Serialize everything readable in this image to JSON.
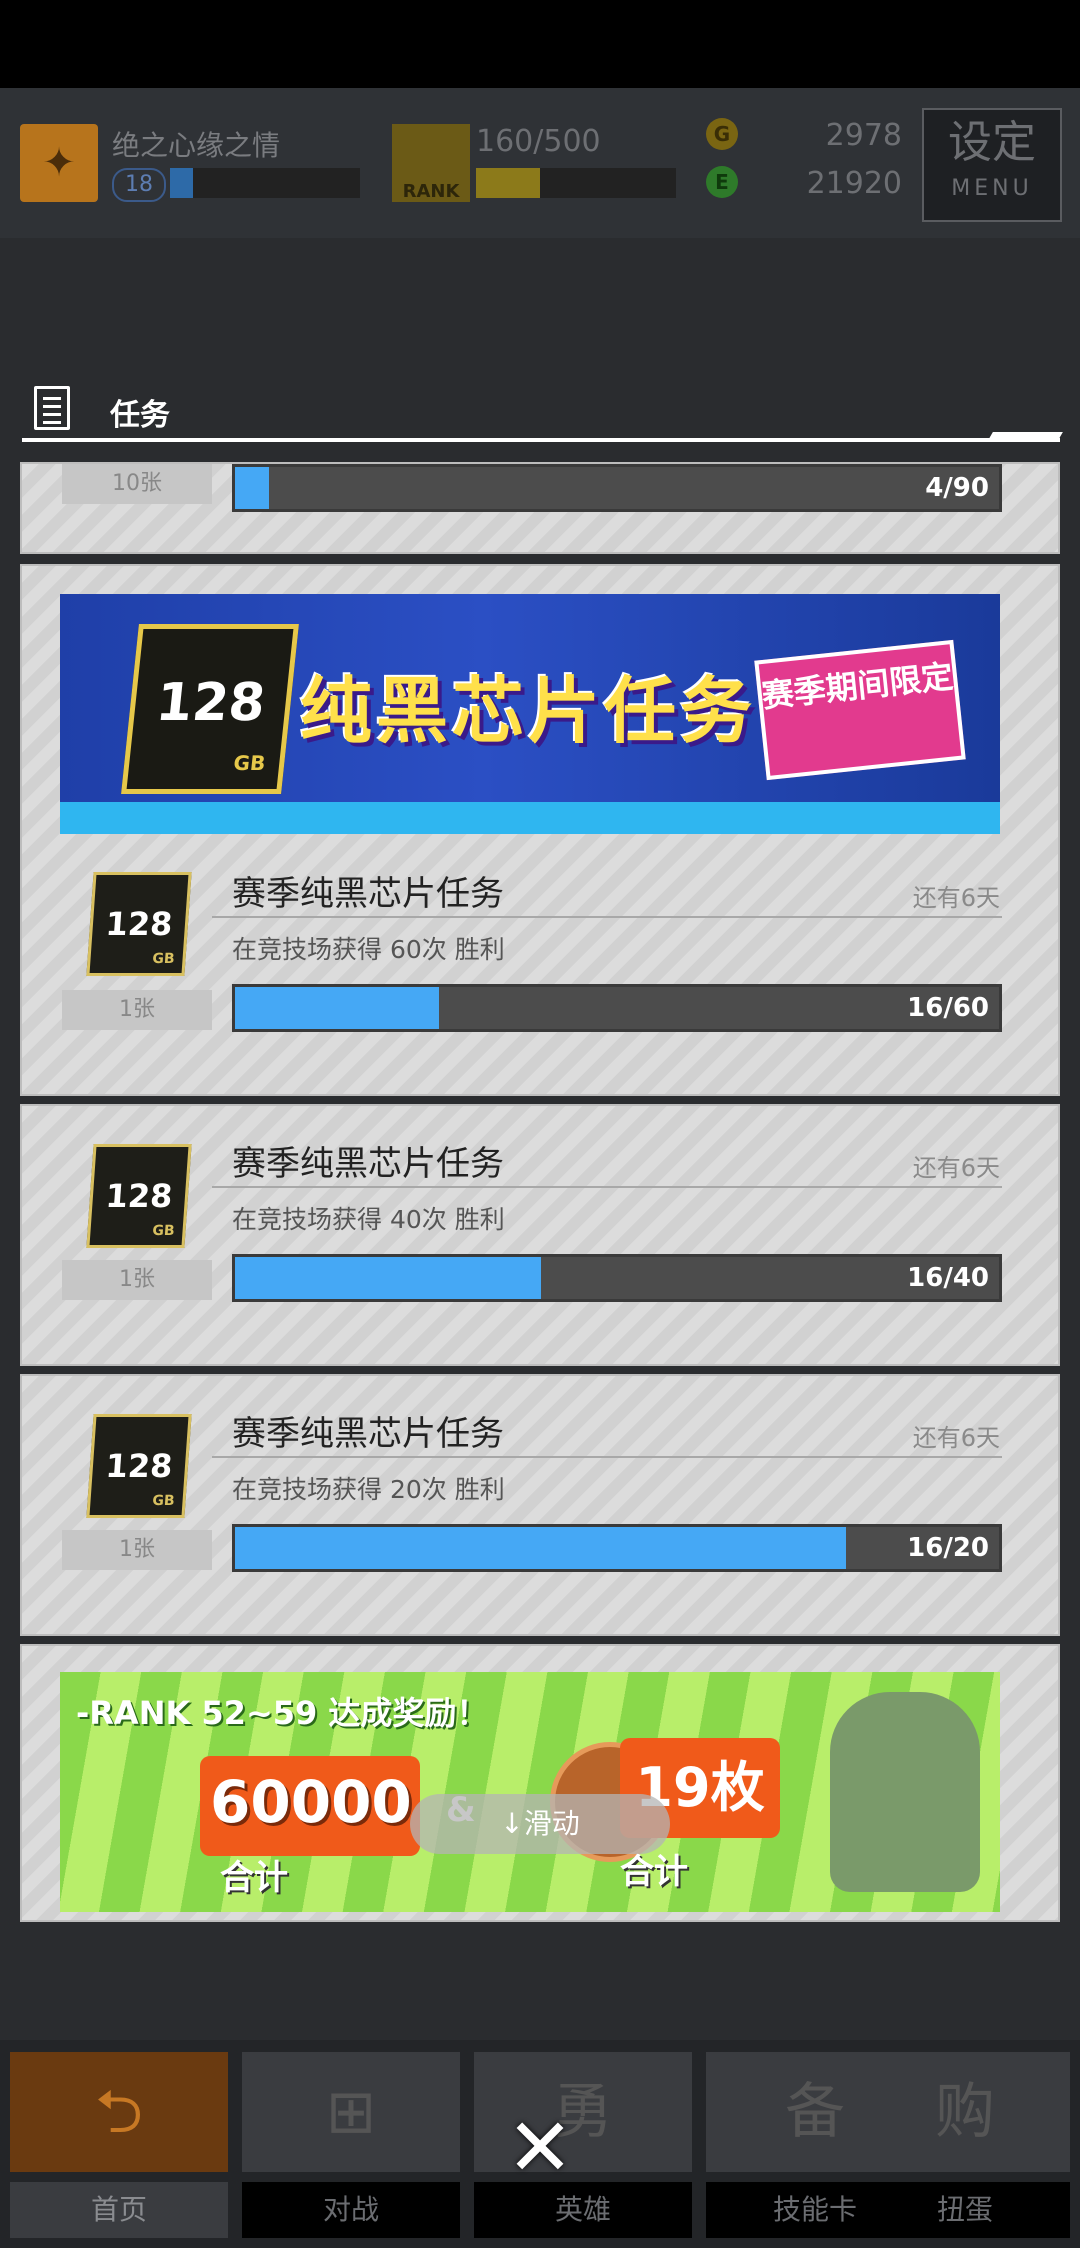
{
  "topbar": {
    "player_name": "绝之心缘之情",
    "level": "18",
    "xp_progress": 0.12,
    "rank_badge": "RANK",
    "rank_progress_text": "160/500",
    "rank_progress": 0.32,
    "coin1_symbol": "G",
    "coin1_value": "2978",
    "coin2_symbol": "E",
    "coin2_value": "21920",
    "menu_big": "设定",
    "menu_small": "MENU"
  },
  "section": {
    "title": "任务"
  },
  "partial_card": {
    "qty": "10张",
    "progress_text": "4/90",
    "progress": 0.044
  },
  "banner1": {
    "chip_num": "128",
    "chip_unit": "GB",
    "title": "纯黑芯片任务",
    "tag": "赛季期间限定"
  },
  "missions": [
    {
      "chip_num": "128",
      "chip_unit": "GB",
      "qty": "1张",
      "title": "赛季纯黑芯片任务",
      "remaining": "还有6天",
      "desc": "在竞技场获得  60次  胜利",
      "progress_text": "16/60",
      "progress": 0.267
    },
    {
      "chip_num": "128",
      "chip_unit": "GB",
      "qty": "1张",
      "title": "赛季纯黑芯片任务",
      "remaining": "还有6天",
      "desc": "在竞技场获得  40次  胜利",
      "progress_text": "16/40",
      "progress": 0.4
    },
    {
      "chip_num": "128",
      "chip_unit": "GB",
      "qty": "1张",
      "title": "赛季纯黑芯片任务",
      "remaining": "还有6天",
      "desc": "在竞技场获得  20次  胜利",
      "progress_text": "16/20",
      "progress": 0.8
    }
  ],
  "banner2": {
    "heading": "-RANK 52~59 达成奖励！",
    "amount": "60000",
    "amp": "&",
    "sum1": "合计",
    "count": "19枚",
    "sum2": "合计"
  },
  "scroll_hint": "↓滑动",
  "nav": [
    {
      "label": "首页",
      "glyph": "⮌",
      "active": true
    },
    {
      "label": "对战",
      "glyph": "⊞",
      "active": false
    },
    {
      "label": "英雄",
      "glyph": "勇",
      "active": false
    },
    {
      "label": "技能卡",
      "glyph": "备",
      "active": false
    },
    {
      "label": "扭蛋",
      "glyph": "购",
      "active": false
    }
  ],
  "close_glyph": "✕",
  "colors": {
    "progress_fill": "#45a8f5",
    "banner_blue": "#2b4fc4",
    "tag_pink": "#e23a8e"
  }
}
